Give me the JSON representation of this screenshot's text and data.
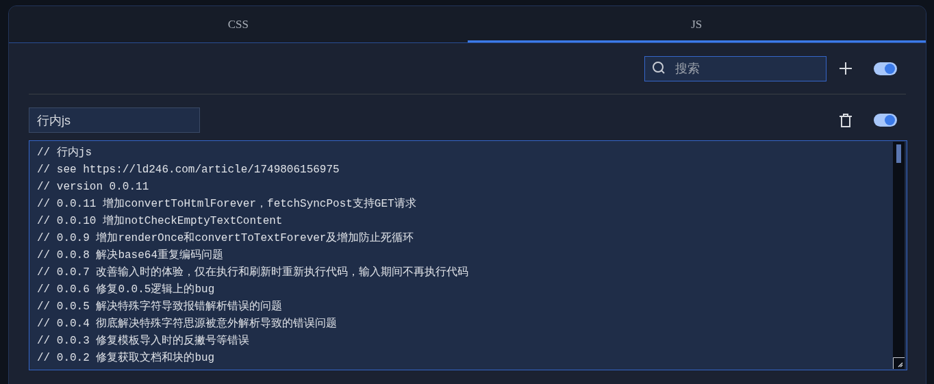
{
  "tabs": [
    {
      "label": "CSS",
      "selected": false
    },
    {
      "label": "JS",
      "selected": true
    }
  ],
  "search": {
    "placeholder": "搜索"
  },
  "master_switch": {
    "on": true
  },
  "snippets": [
    {
      "name": "行内js",
      "on": true,
      "code": [
        "// 行内js",
        "// see https://ld246.com/article/1749806156975",
        "// version 0.0.11",
        "// 0.0.11 增加convertToHtmlForever，fetchSyncPost支持GET请求",
        "// 0.0.10 增加notCheckEmptyTextContent",
        "// 0.0.9 增加renderOnce和convertToTextForever及增加防止死循环",
        "// 0.0.8 解决base64重复编码问题",
        "// 0.0.7 改善输入时的体验，仅在执行和刷新时重新执行代码，输入期间不再执行代码",
        "// 0.0.6 修复0.0.5逻辑上的bug",
        "// 0.0.5 解决特殊字符导致报错解析错误的问题",
        "// 0.0.4 彻底解决特殊字符思源被意外解析导致的错误问题",
        "// 0.0.3 修复模板导入时的反撇号等错误",
        "// 0.0.2 修复获取文档和块的bug"
      ]
    }
  ]
}
